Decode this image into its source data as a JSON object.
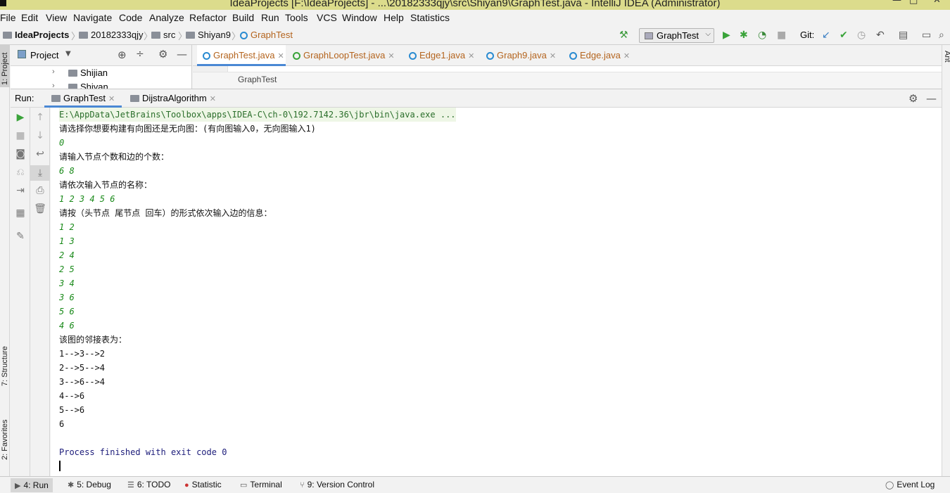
{
  "window": {
    "title": "IdeaProjects [F:\\IdeaProjects] - ...\\20182333qjy\\src\\Shiyan9\\GraphTest.java - IntelliJ IDEA (Administrator)"
  },
  "menu": [
    "File",
    "Edit",
    "View",
    "Navigate",
    "Code",
    "Analyze",
    "Refactor",
    "Build",
    "Run",
    "Tools",
    "VCS",
    "Window",
    "Help",
    "Statistics"
  ],
  "breadcrumb": [
    "IdeaProjects",
    "20182333qjy",
    "src",
    "Shiyan9",
    "GraphTest"
  ],
  "toolbar": {
    "run_config": "GraphTest",
    "git_label": "Git:"
  },
  "left_strip": {
    "project": "1: Project",
    "structure": "7: Structure",
    "favorites": "2: Favorites"
  },
  "right_strip": {
    "ant": "Ant"
  },
  "project_panel": {
    "title": "Project",
    "items": [
      "Shijian",
      "Shiyan"
    ]
  },
  "editor": {
    "tabs": [
      "GraphTest.java",
      "GraphLoopTest.java",
      "Edge1.java",
      "Graph9.java",
      "Edge.java"
    ],
    "breadcrumb": "GraphTest"
  },
  "run_panel": {
    "label": "Run:",
    "tabs": [
      "GraphTest",
      "DijstraAlgorithm"
    ]
  },
  "console": {
    "lines": [
      {
        "text": "E:\\AppData\\JetBrains\\Toolbox\\apps\\IDEA-C\\ch-0\\192.7142.36\\jbr\\bin\\java.exe ...",
        "kind": "cmd"
      },
      {
        "text": "请选择你想要构建有向图还是无向图：(有向图输入0，无向图输入1)",
        "kind": "out"
      },
      {
        "text": "0",
        "kind": "in"
      },
      {
        "text": "请输入节点个数和边的个数：",
        "kind": "out"
      },
      {
        "text": "6 8",
        "kind": "in"
      },
      {
        "text": "请依次输入节点的名称：",
        "kind": "out"
      },
      {
        "text": "1 2 3 4 5 6",
        "kind": "in"
      },
      {
        "text": "请按（头节点 尾节点 回车）的形式依次输入边的信息：",
        "kind": "out"
      },
      {
        "text": "1 2",
        "kind": "in"
      },
      {
        "text": "1 3",
        "kind": "in"
      },
      {
        "text": "2 4",
        "kind": "in"
      },
      {
        "text": "2 5",
        "kind": "in"
      },
      {
        "text": "3 4",
        "kind": "in"
      },
      {
        "text": "3 6",
        "kind": "in"
      },
      {
        "text": "5 6",
        "kind": "in"
      },
      {
        "text": "4 6",
        "kind": "in"
      },
      {
        "text": "该图的邻接表为：",
        "kind": "out"
      },
      {
        "text": "1-->3-->2",
        "kind": "out"
      },
      {
        "text": "2-->5-->4",
        "kind": "out"
      },
      {
        "text": "3-->6-->4",
        "kind": "out"
      },
      {
        "text": "4-->6",
        "kind": "out"
      },
      {
        "text": "5-->6",
        "kind": "out"
      },
      {
        "text": "6",
        "kind": "out"
      },
      {
        "text": "",
        "kind": "out"
      },
      {
        "text": "Process finished with exit code 0",
        "kind": "sys"
      }
    ]
  },
  "statusbar": {
    "items": [
      "4: Run",
      "5: Debug",
      "6: TODO",
      "Statistic",
      "Terminal",
      "9: Version Control"
    ],
    "event_log": "Event Log"
  }
}
